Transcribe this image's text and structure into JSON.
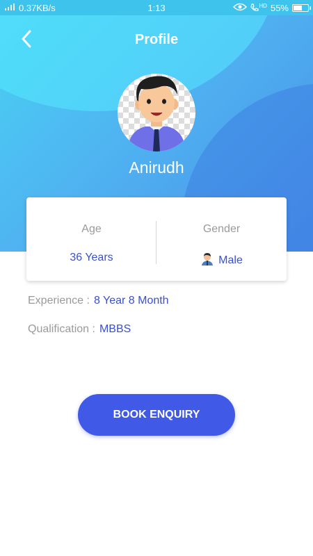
{
  "status_bar": {
    "left_text": "0.37KB/s",
    "time": "1:13",
    "battery_text": "55%",
    "battery_level": 0.55,
    "hd_text": "HD"
  },
  "header": {
    "title": "Profile",
    "back_icon": "chevron-left-icon"
  },
  "profile": {
    "name": "Anirudh",
    "avatar_icon": "man-avatar"
  },
  "info_card": {
    "age_label": "Age",
    "age_value": "36 Years",
    "gender_label": "Gender",
    "gender_value": "Male",
    "gender_icon": "male-person-icon"
  },
  "details": {
    "experience_label": "Experience :",
    "experience_value": "8 Year 8 Month",
    "qualification_label": "Qualification :",
    "qualification_value": "MBBS"
  },
  "actions": {
    "book_label": "BOOK ENQUIRY"
  },
  "colors": {
    "accent": "#4059e6",
    "value_text": "#3a4fcf",
    "header_start": "#48d3f3",
    "header_end": "#4a8fe8"
  }
}
